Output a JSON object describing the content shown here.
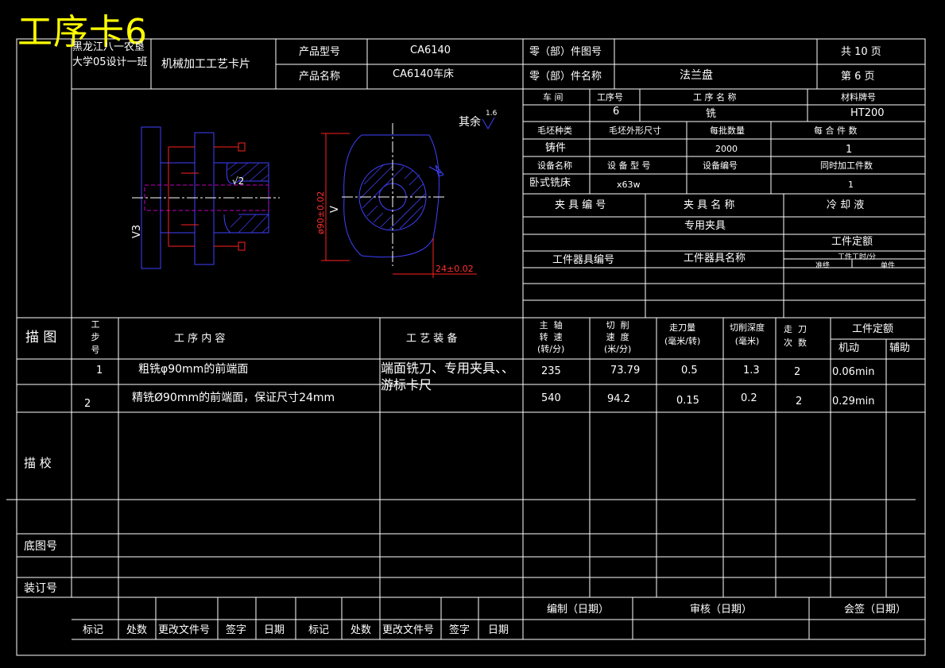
{
  "page_title": "工序卡6",
  "header": {
    "school": "黑龙江八一农垦大学05设计一班",
    "card_title": "机械加工工艺卡片",
    "product_model_label": "产品型号",
    "product_model": "CA6140",
    "product_name_label": "产品名称",
    "product_name": "CA6140车床",
    "part_drawing_no_label": "零（部）件图号",
    "part_name_label": "零（部）件名称",
    "part_name": "法兰盘",
    "total_pages": "共  10 页",
    "page_no": "第  6  页"
  },
  "info": {
    "workshop_label": "车  间",
    "process_no_label": "工序号",
    "process_name_label": "工  序  名  称",
    "material_label": "材料牌号",
    "process_no": "6",
    "process_name": "铣",
    "material": "HT200",
    "blank_type_label": "毛坯种类",
    "blank_size_label": "毛坯外形尺寸",
    "batch_qty_label": "每批数量",
    "pieces_label": "每  合  件  数",
    "blank_type": "铸件",
    "batch_qty": "2000",
    "pieces": "1",
    "equip_name_label": "设备名称",
    "equip_model_label": "设  备  型  号",
    "equip_no_label": "设备编号",
    "simul_label": "同时加工件数",
    "equip_name": "卧式铣床",
    "equip_model": "x63w",
    "simul": "1",
    "fixture_no_label": "夹 具 编 号",
    "fixture_name_label": "夹 具 名 称",
    "coolant_label": "冷  却  液",
    "fixture_name": "专用夹具",
    "quota_label": "工件定额",
    "quota_sub": "工件工时/分",
    "quota_prep": "准终",
    "quota_unit": "单件",
    "tool_no_label": "工件器具编号",
    "tool_name_label": "工件器具名称"
  },
  "drawing": {
    "roughness_rest": "其余",
    "roughness_val": "1.6",
    "dim_dia": "ø90±0.02",
    "dim_len": "24±0.02",
    "mark_v2": "√2",
    "mark_v3": "V3",
    "mark_v": "V"
  },
  "table": {
    "sketch_label": "描 图",
    "step_label": "工步号",
    "content_label": "工  序  内  容",
    "equip_label": "工  艺  装  备",
    "spindle_label": "主  轴\n转  速\n(转/分)",
    "cut_speed_label": "切  削\n速  度\n(米/分)",
    "feed_label": "走刀量\n(毫米/转)",
    "depth_label": "切削深度\n(毫米)",
    "passes_label": "走  刀\n次  数",
    "time_label": "工件定额",
    "machine_label": "机动",
    "aux_label": "辅助",
    "rows": [
      {
        "step": "1",
        "content": "粗铣φ90mm的前端面",
        "equipment": "端面铣刀、专用夹具、、游标卡尺",
        "spindle": "235",
        "speed": "73.79",
        "feed": "0.5",
        "depth": "1.3",
        "passes": "2",
        "time": "0.06min"
      },
      {
        "step": "2",
        "content": "精铣Ø90mm的前端面，保证尺寸24mm",
        "equipment": "",
        "spindle": "540",
        "speed": "94.2",
        "feed": "0.15",
        "depth": "0.2",
        "passes": "2",
        "time": "0.29min"
      }
    ]
  },
  "side": {
    "check_label": "描 校",
    "base_no_label": "底图号",
    "binding_label": "装订号"
  },
  "footer": {
    "labels": [
      "标记",
      "处数",
      "更改文件号",
      "签字",
      "日期",
      "标记",
      "处数",
      "更改文件号",
      "签字",
      "日期"
    ],
    "compile": "编制（日期）",
    "review": "审核（日期）",
    "sign": "会签（日期）"
  }
}
